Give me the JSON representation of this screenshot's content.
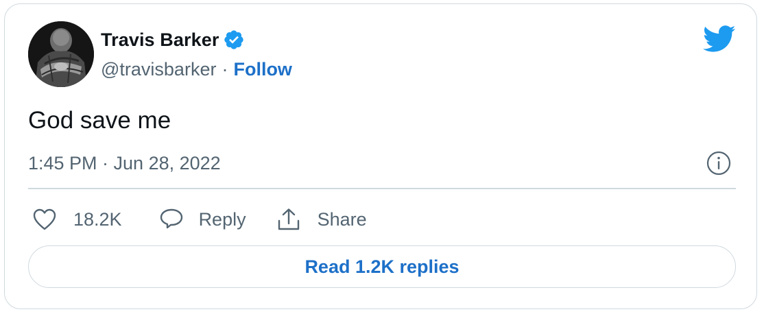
{
  "author": {
    "display_name": "Travis Barker",
    "handle": "@travisbarker",
    "separator": "·",
    "follow_label": "Follow",
    "verified": true
  },
  "tweet": {
    "text": "God save me",
    "timestamp": "1:45 PM · Jun 28, 2022"
  },
  "actions": {
    "like_count": "18.2K",
    "reply_label": "Reply",
    "share_label": "Share"
  },
  "read_replies_label": "Read 1.2K replies",
  "colors": {
    "accent": "#1d9bf0",
    "link": "#1d70c8",
    "secondary_text": "#536471",
    "border": "#cfd9de",
    "primary_text": "#0f1419"
  },
  "icons": {
    "avatar": "avatar-photo",
    "verified": "verified-badge-icon",
    "logo": "twitter-bird-icon",
    "info": "info-icon",
    "like": "heart-icon",
    "reply": "speech-bubble-icon",
    "share": "share-upload-icon"
  }
}
